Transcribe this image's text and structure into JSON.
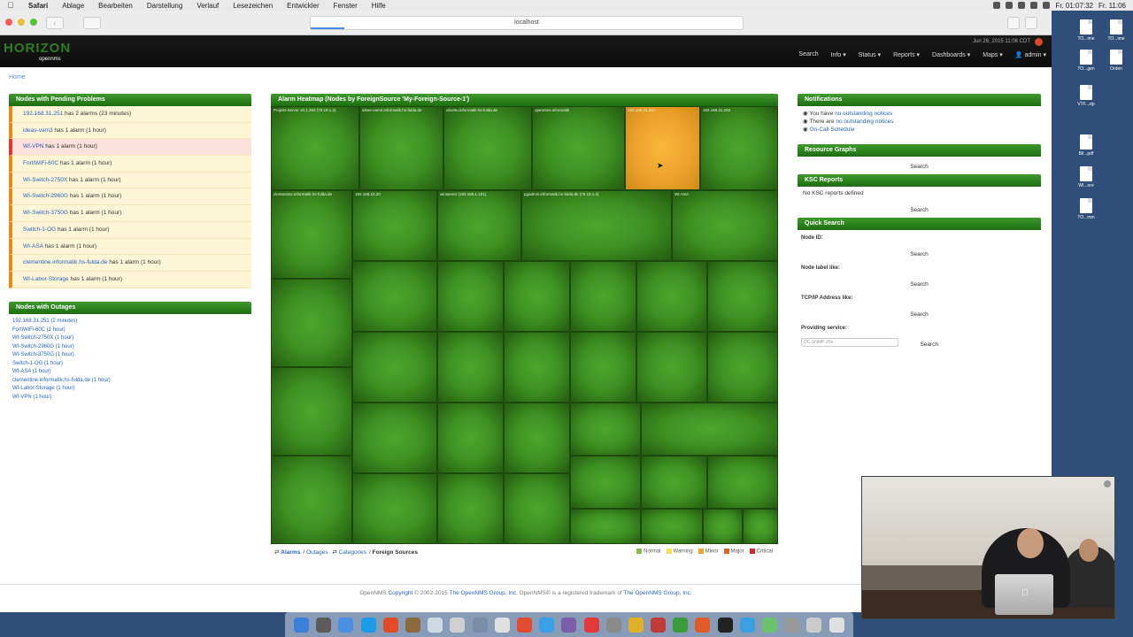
{
  "menubar": {
    "apple": "",
    "items": [
      "Safari",
      "Ablage",
      "Bearbeiten",
      "Darstellung",
      "Verlauf",
      "Lesezeichen",
      "Entwickler",
      "Fenster",
      "Hilfe"
    ],
    "right": [
      "Fr. 01:07:32",
      "Fr. 11:06"
    ]
  },
  "browser": {
    "url": "localhost"
  },
  "header": {
    "logo": "HORIZON",
    "logo_sub": "opennms",
    "date": "Jun 26, 2015 11:06 CDT",
    "nav": [
      "Search",
      "Info ▾",
      "Status ▾",
      "Reports ▾",
      "Dashboards ▾",
      "Maps ▾",
      "👤 admin ▾"
    ]
  },
  "breadcrumb": "Home",
  "pending": {
    "title": "Nodes with Pending Problems",
    "rows": [
      {
        "host": "192.168.31.251",
        "text": " has 2 alarms (23 minutes)",
        "severity": "minor"
      },
      {
        "host": "ideas-vam3",
        "text": " has 1 alarm (1 hour)",
        "severity": "minor"
      },
      {
        "host": "WI-VPN",
        "text": " has 1 alarm (1 hour)",
        "severity": "major"
      },
      {
        "host": "FortiWiFi-60C",
        "text": " has 1 alarm (1 hour)",
        "severity": "minor"
      },
      {
        "host": "WI-Switch-2750X",
        "text": " has 1 alarm (1 hour)",
        "severity": "minor"
      },
      {
        "host": "WI-Switch-2960G",
        "text": " has 1 alarm (1 hour)",
        "severity": "minor"
      },
      {
        "host": "WI-Switch-3750G",
        "text": " has 1 alarm (1 hour)",
        "severity": "minor"
      },
      {
        "host": "Switch-1-OG",
        "text": " has 1 alarm (1 hour)",
        "severity": "minor"
      },
      {
        "host": "WI-ASA",
        "text": " has 1 alarm (1 hour)",
        "severity": "minor"
      },
      {
        "host": "clementine.informatik.hs-fulda.de",
        "text": " has 1 alarm (1 hour)",
        "severity": "minor"
      },
      {
        "host": "WI-Labor-Storage",
        "text": " has 1 alarm (1 hour)",
        "severity": "minor"
      }
    ]
  },
  "outages": {
    "title": "Nodes with Outages",
    "rows": [
      "192.168.31.251 (2 minutes)",
      "FortiWiFi-60C (1 hour)",
      "WI-Switch-2750X (1 hour)",
      "WI-Switch-2960G (1 hour)",
      "WI-Switch-3750G (1 hour)",
      "Switch-1-OG (1 hour)",
      "WI-ASA (1 hour)",
      "clementine.informatik.hs-fulda.de (1 hour)",
      "WI-Labor-Storage (1 hour)",
      "WI-VPN (1 hour)"
    ]
  },
  "heatmap": {
    "title": "Alarm Heatmap (Nodes by ForeignSource 'My-Foreign-Source-1')",
    "cells": [
      {
        "label": "Projekt-Server 10.1.253 (79.19.1.3)",
        "sev": "normal"
      },
      {
        "label": "ideas-vam3.informatik.hs-fulda.de",
        "sev": "normal"
      },
      {
        "label": "ubuntu.informatik.hs-fulda.de",
        "sev": "normal"
      },
      {
        "label": "opennms.informatik",
        "sev": "normal"
      },
      {
        "label": "192.168.31.251",
        "sev": "warning"
      },
      {
        "label": "192.168.31.252",
        "sev": "normal"
      },
      {
        "label": "clementine.informatik.hs-fulda.de",
        "sev": "normal"
      },
      {
        "label": "192.168.10.20",
        "sev": "normal"
      },
      {
        "label": "winserver (192.168.1.101)",
        "sev": "normal"
      },
      {
        "label": "pgadmin.informatik.hs-fulda.de (79.19.1.4)",
        "sev": "normal"
      },
      {
        "label": "WI-ASA",
        "sev": "normal"
      }
    ],
    "footer": {
      "links": [
        "Alarms",
        "Outages",
        "Categories",
        "Foreign Sources"
      ],
      "icons": [
        "⇄",
        "⇄"
      ],
      "sep": "/"
    },
    "legend": [
      {
        "label": "Normal",
        "color": "#8ab84a"
      },
      {
        "label": "Warning",
        "color": "#f5e24a"
      },
      {
        "label": "Minor",
        "color": "#f0a52a"
      },
      {
        "label": "Major",
        "color": "#e2632a"
      },
      {
        "label": "Critical",
        "color": "#d8262b"
      }
    ]
  },
  "notifications": {
    "title": "Notifications",
    "lines": [
      {
        "pre": "You have ",
        "link": "no outstanding notices"
      },
      {
        "pre": "There are ",
        "link": "no outstanding notices"
      },
      {
        "pre": "",
        "link": "On-Call Schedule"
      }
    ]
  },
  "resource_graphs": {
    "title": "Resource Graphs",
    "search": "Search"
  },
  "ksc": {
    "title": "KSC Reports",
    "empty": "No KSC reports defined",
    "search": "Search"
  },
  "quick_search": {
    "title": "Quick Search",
    "fields": [
      {
        "label": "Node ID:",
        "search": "Search"
      },
      {
        "label": "Node label like:",
        "search": "Search"
      },
      {
        "label": "TCP/IP Address like:",
        "search": "Search"
      }
    ],
    "service_label": "Providing service:",
    "service_value": "DC-SNMP-20s",
    "service_search": "Search"
  },
  "footer": {
    "prefix": "OpenNMS ",
    "copyright": "Copyright",
    "middle": " © 2002-2015 ",
    "group": "The OpenNMS Group, Inc.",
    "tm": " OpenNMS® is a registered trademark of ",
    "group2": "The OpenNMS Group, Inc."
  },
  "desktop_files": [
    "TO...ime",
    "TO...ime",
    "TO...gen",
    "Orden",
    "VTF...zip",
    "Bil...pdf",
    "WI...ore",
    "TO...mm"
  ],
  "colors": {
    "panel_green": "#2f8a1c",
    "warning_cell": "#eda22c",
    "pending_minor": "#e68a1a",
    "pending_major": "#e0382e"
  }
}
